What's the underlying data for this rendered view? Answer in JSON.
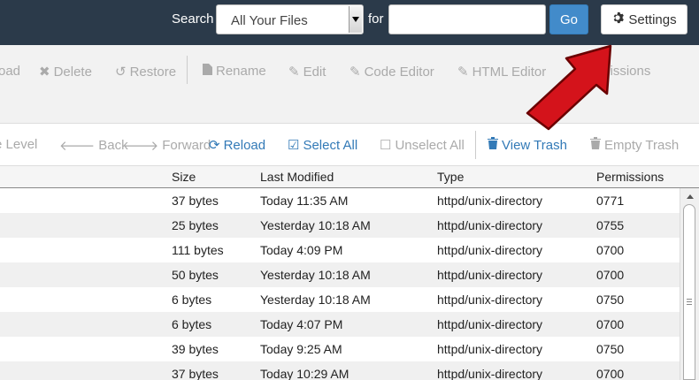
{
  "search": {
    "label": "Search",
    "scope_value": "All Your Files",
    "for_label": "for",
    "query_value": "",
    "go_label": "Go",
    "settings_label": "Settings"
  },
  "toolbar": {
    "items": [
      {
        "label": "oad",
        "icon": "upload-icon"
      },
      {
        "label": "Delete",
        "icon": "times-icon"
      },
      {
        "label": "Restore",
        "icon": "undo-icon"
      },
      {
        "label": "Rename",
        "icon": "file-icon"
      },
      {
        "label": "Edit",
        "icon": "pencil-icon"
      },
      {
        "label": "Code Editor",
        "icon": "edit-icon"
      },
      {
        "label": "HTML Editor",
        "icon": "edit-icon"
      },
      {
        "label": "missions",
        "icon": "key-icon"
      }
    ]
  },
  "navbar": {
    "items": [
      {
        "label": "e Level",
        "state": "disabled"
      },
      {
        "label": "Back",
        "state": "disabled",
        "icon": "arrow-left-icon"
      },
      {
        "label": "Forward",
        "state": "disabled",
        "icon": "arrow-right-icon"
      },
      {
        "label": "Reload",
        "state": "active",
        "icon": "refresh-icon"
      },
      {
        "label": "Select All",
        "state": "active",
        "icon": "check-square-icon"
      },
      {
        "label": "Unselect All",
        "state": "disabled",
        "icon": "square-icon"
      },
      {
        "label": "View Trash",
        "state": "active",
        "icon": "trash-icon"
      },
      {
        "label": "Empty Trash",
        "state": "disabled",
        "icon": "trash-icon"
      }
    ]
  },
  "table": {
    "columns": [
      "Size",
      "Last Modified",
      "Type",
      "Permissions"
    ],
    "rows": [
      [
        "37 bytes",
        "Today 11:35 AM",
        "httpd/unix-directory",
        "0771"
      ],
      [
        "25 bytes",
        "Yesterday 10:18 AM",
        "httpd/unix-directory",
        "0755"
      ],
      [
        "111 bytes",
        "Today 4:09 PM",
        "httpd/unix-directory",
        "0700"
      ],
      [
        "50 bytes",
        "Yesterday 10:18 AM",
        "httpd/unix-directory",
        "0700"
      ],
      [
        "6 bytes",
        "Yesterday 10:18 AM",
        "httpd/unix-directory",
        "0750"
      ],
      [
        "6 bytes",
        "Today 4:07 PM",
        "httpd/unix-directory",
        "0700"
      ],
      [
        "39 bytes",
        "Today 9:25 AM",
        "httpd/unix-directory",
        "0750"
      ],
      [
        "37 bytes",
        "Today 10:29 AM",
        "httpd/unix-directory",
        "0700"
      ]
    ]
  },
  "colors": {
    "topbar": "#2b3a4a",
    "accent": "#337ab7",
    "arrow": "#d4131b"
  }
}
